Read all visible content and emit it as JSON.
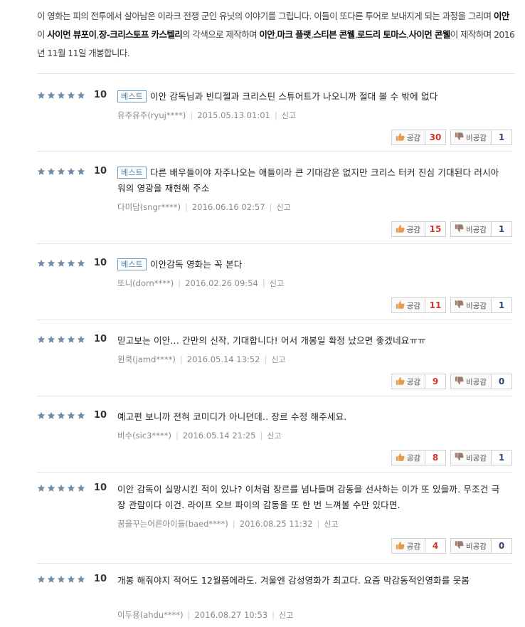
{
  "intro": {
    "t1": "이 영화는 피의 전투에서 살아남은 이라크 전쟁 군인 유닛의 이야기를 그립니다. 이들이 또다른 투어로 보내지게 되는 과정을 그리며 ",
    "b1": "이안",
    "t2": "이 ",
    "b2": "사이먼 뷰포이",
    "t3": ",",
    "b3": "장-크리스토프 카스텔리",
    "t4": "의 각색으로 제작하며 ",
    "b4": "이안",
    "t5": ",",
    "b5": "마크 플랫",
    "t6": ",",
    "b6": "스티븐 콘웰",
    "t7": ",",
    "b7": "로드리 토마스",
    "t8": ",",
    "b8": "사이먼 콘웰",
    "t9": "이 제작하며 2016년 11월 11일 개봉합니다."
  },
  "labels": {
    "best": "베스트",
    "like": "공감",
    "dislike": "비공감",
    "report": "신고"
  },
  "colors": {
    "star": "#6e8ba8",
    "like_count": "#d4342a",
    "dislike_count": "#2d4a73",
    "best_border": "#6b9cc0"
  },
  "reviews": [
    {
      "score": "10",
      "best": true,
      "text": "이안 감독님과 빈디젤과 크리스틴 스튜어트가 나오니까 절대 볼 수 밖에 없다",
      "user": "유주유주(ryuj****)",
      "date": "2015.05.13 01:01",
      "likes": "30",
      "dislikes": "1"
    },
    {
      "score": "10",
      "best": true,
      "text": "다른 배우들이야 자주나오는 애들이라 큰 기대감은 없지만 크리스 터커 진심 기대된다 러시아워의 영광을 재현해 주소",
      "user": "다미담(sngr****)",
      "date": "2016.06.16 02:57",
      "likes": "15",
      "dislikes": "1"
    },
    {
      "score": "10",
      "best": true,
      "text": "이안감독 영화는 꼭 본다",
      "user": "또니(dorn****)",
      "date": "2016.02.26 09:54",
      "likes": "11",
      "dislikes": "1"
    },
    {
      "score": "10",
      "best": false,
      "text": "믿고보는 이안... 간만의 신작, 기대합니다! 어서 개봉일 확정 났으면 좋겠네요ㅠㅠ",
      "user": "윈쿡(jamd****)",
      "date": "2016.05.14 13:52",
      "likes": "9",
      "dislikes": "0"
    },
    {
      "score": "10",
      "best": false,
      "text": "예고편 보니까 전혀 코미디가 아니던데.. 장르 수정 해주세요.",
      "user": "비수(sic3****)",
      "date": "2016.05.14 21:25",
      "likes": "8",
      "dislikes": "1"
    },
    {
      "score": "10",
      "best": false,
      "text": "이안 감독이 실망시킨 적이 있나? 이처럼 장르를 넘나들며 감동을 선사하는 이가 또 있을까. 무조건 극장 관람이다 이건. 라이프 오브 파이의 감동을 또 한 번 느껴볼 수만 있다면.",
      "user": "꿈을꾸는어른아이들(baed****)",
      "date": "2016.08.25 11:32",
      "likes": "4",
      "dislikes": "0"
    },
    {
      "score": "10",
      "best": false,
      "text": "개봉 해줘야지 적어도 12월쯤에라도. 겨울엔 감성영화가 최고다. 요즘 막감동적인영화를 못봄",
      "user": "이두용(ahdu****)",
      "date": "2016.08.27 10:53",
      "likes": null,
      "dislikes": null
    }
  ]
}
